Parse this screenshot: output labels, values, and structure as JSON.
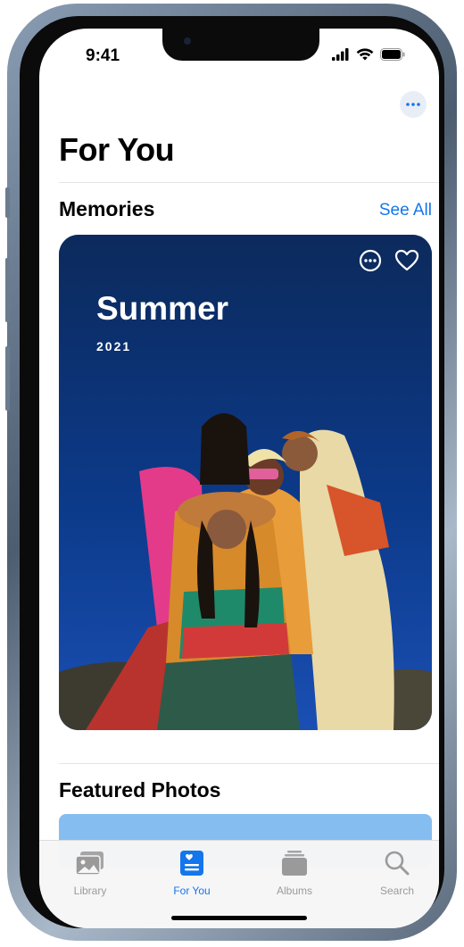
{
  "status_bar": {
    "time": "9:41"
  },
  "header": {
    "title": "For You"
  },
  "memories": {
    "title": "Memories",
    "see_all": "See All",
    "card": {
      "title": "Summer",
      "year": "2021"
    }
  },
  "featured": {
    "title": "Featured Photos"
  },
  "tab_bar": {
    "tabs": [
      {
        "label": "Library",
        "icon": "photo-stack-icon",
        "active": false
      },
      {
        "label": "For You",
        "icon": "for-you-icon",
        "active": true
      },
      {
        "label": "Albums",
        "icon": "albums-icon",
        "active": false
      },
      {
        "label": "Search",
        "icon": "search-icon",
        "active": false
      }
    ]
  },
  "colors": {
    "accent": "#1476ec",
    "card_background": "#0b2f70"
  }
}
